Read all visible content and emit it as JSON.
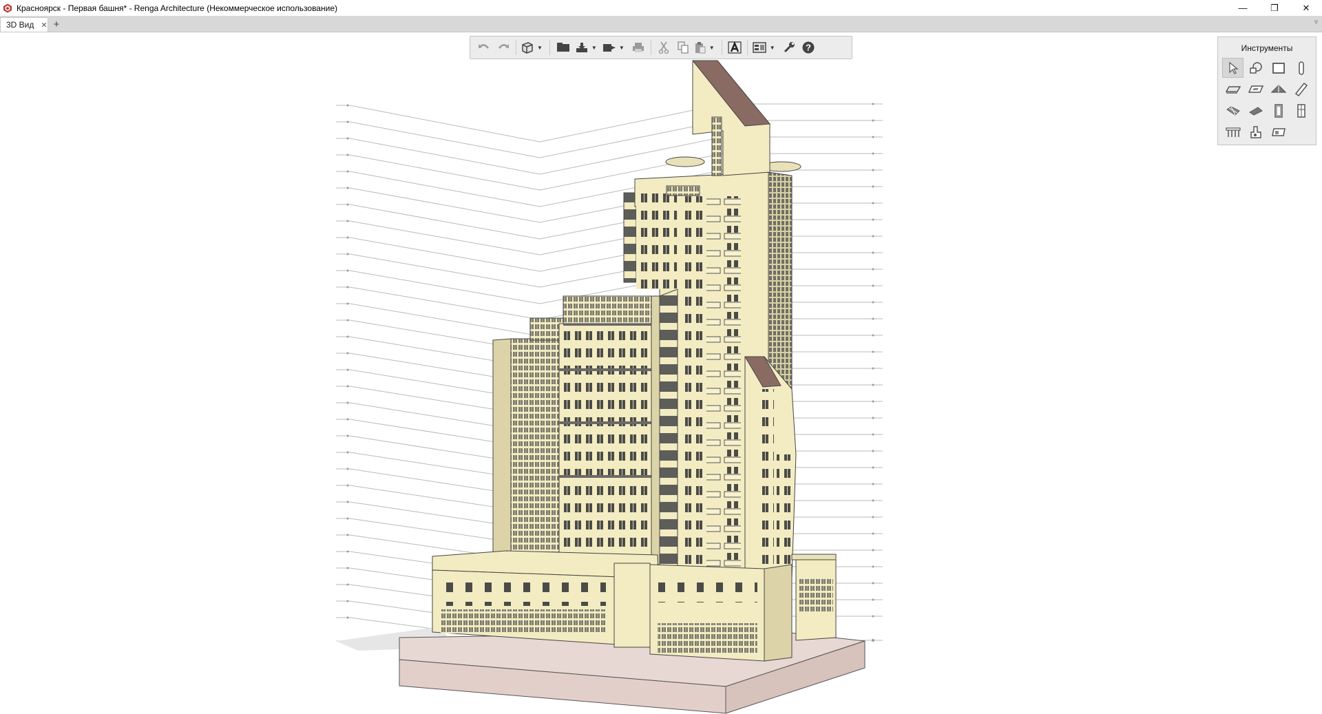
{
  "window": {
    "title": "Красноярск - Первая башня* - Renga Architecture (Некоммерческое использование)",
    "controls": {
      "minimize": "—",
      "restore": "❐",
      "close": "✕"
    }
  },
  "tabs": [
    {
      "label": "3D Вид",
      "close": "✕",
      "active": true
    }
  ],
  "tab_add": "+",
  "tab_menu": "▿",
  "toolbar": {
    "buttons": [
      {
        "name": "undo-icon"
      },
      {
        "name": "redo-icon"
      },
      {
        "name": "view-cube-icon",
        "dropdown": true
      },
      {
        "name": "open-folder-icon"
      },
      {
        "name": "import-icon",
        "dropdown": true
      },
      {
        "name": "export-icon",
        "dropdown": true
      },
      {
        "name": "print-icon"
      },
      {
        "name": "cut-icon"
      },
      {
        "name": "copy-icon"
      },
      {
        "name": "paste-icon",
        "dropdown": true
      },
      {
        "name": "text-style-icon"
      },
      {
        "name": "display-settings-icon",
        "dropdown": true
      },
      {
        "name": "settings-wrench-icon"
      },
      {
        "name": "help-icon"
      }
    ],
    "dropdown_glyph": "▼"
  },
  "tools_panel": {
    "title": "Инструменты",
    "tools": [
      {
        "name": "select-tool-icon",
        "active": true
      },
      {
        "name": "assembly-tool-icon"
      },
      {
        "name": "wall-tool-icon"
      },
      {
        "name": "column-tool-icon"
      },
      {
        "name": "floor-slab-tool-icon"
      },
      {
        "name": "opening-tool-icon"
      },
      {
        "name": "roof-tool-icon"
      },
      {
        "name": "beam-tool-icon"
      },
      {
        "name": "stair-tool-icon"
      },
      {
        "name": "ramp-tool-icon"
      },
      {
        "name": "door-tool-icon"
      },
      {
        "name": "window-tool-icon"
      },
      {
        "name": "railing-tool-icon"
      },
      {
        "name": "equipment-tool-icon"
      },
      {
        "name": "room-tool-icon"
      }
    ]
  },
  "colors": {
    "facade": "#f3ecc2",
    "facade_shade": "#dcd4a8",
    "roof": "#8a6b63",
    "foundation": "#e8d8d3",
    "level_line": "#b9b9b9",
    "tab_bar": "#d8d8d8",
    "panel_bg": "#ececec"
  }
}
